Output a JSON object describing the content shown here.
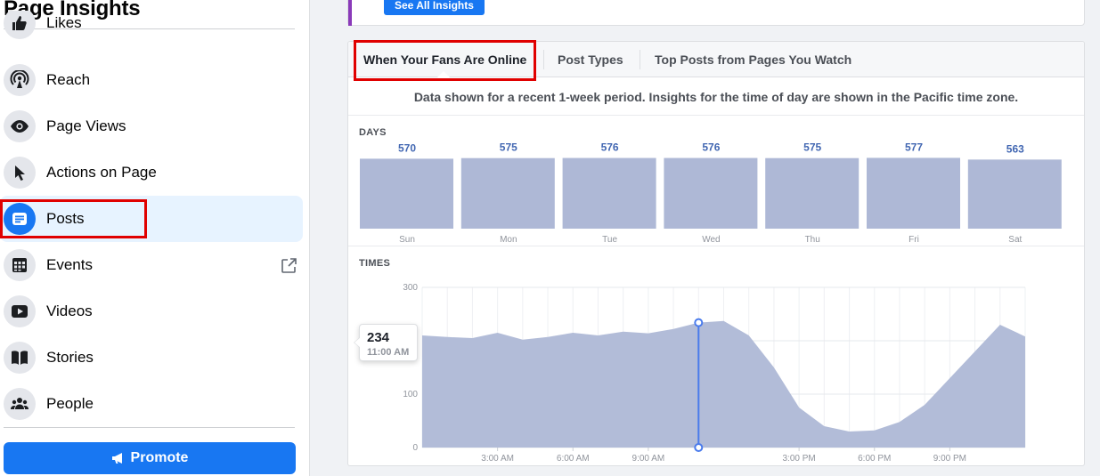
{
  "sidebar": {
    "title": "Page Insights",
    "items": [
      {
        "label": "Likes",
        "icon": "thumbs-up-icon"
      },
      {
        "label": "Reach",
        "icon": "broadcast-icon"
      },
      {
        "label": "Page Views",
        "icon": "eye-icon"
      },
      {
        "label": "Actions on Page",
        "icon": "cursor-icon"
      },
      {
        "label": "Posts",
        "icon": "posts-icon",
        "selected": true
      },
      {
        "label": "Events",
        "icon": "calendar-icon",
        "external": true
      },
      {
        "label": "Videos",
        "icon": "play-icon"
      },
      {
        "label": "Stories",
        "icon": "book-icon"
      },
      {
        "label": "People",
        "icon": "people-icon"
      }
    ],
    "promote_label": "Promote"
  },
  "top_card": {
    "button_label": "See All Insights"
  },
  "tabs": [
    "When Your Fans Are Online",
    "Post Types",
    "Top Posts from Pages You Watch"
  ],
  "active_tab": "When Your Fans Are Online",
  "note": "Data shown for a recent 1-week period. Insights for the time of day are shown in the Pacific time zone.",
  "days_label": "DAYS",
  "times_label": "TIMES",
  "colors": {
    "accent": "#1877f2",
    "bar": "#aeb8d6",
    "value_text": "#4267b2",
    "highlight": "#e00000",
    "tooltip_line": "#4a7bec"
  },
  "tooltip": {
    "value": "234",
    "time": "11:00 AM"
  },
  "chart_data": [
    {
      "type": "bar",
      "title": "DAYS",
      "categories": [
        "Sun",
        "Mon",
        "Tue",
        "Wed",
        "Thu",
        "Fri",
        "Sat"
      ],
      "values": [
        570,
        575,
        576,
        576,
        575,
        577,
        563
      ]
    },
    {
      "type": "area",
      "title": "TIMES",
      "x": [
        0,
        1,
        2,
        3,
        4,
        5,
        6,
        7,
        8,
        9,
        10,
        11,
        12,
        13,
        14,
        15,
        16,
        17,
        18,
        19,
        20,
        21,
        22,
        23
      ],
      "x_tick_labels": [
        "3:00 AM",
        "6:00 AM",
        "9:00 AM",
        "3:00 PM",
        "6:00 PM",
        "9:00 PM"
      ],
      "x_tick_hours": [
        3,
        6,
        9,
        15,
        18,
        21
      ],
      "values": [
        210,
        207,
        205,
        215,
        202,
        207,
        215,
        210,
        217,
        214,
        222,
        234,
        237,
        210,
        150,
        75,
        40,
        30,
        32,
        48,
        80,
        130,
        180,
        230,
        208
      ],
      "ylim": [
        0,
        300
      ],
      "y_ticks": [
        0,
        100,
        200,
        300
      ],
      "grid": true,
      "highlight_hour": 11
    }
  ]
}
